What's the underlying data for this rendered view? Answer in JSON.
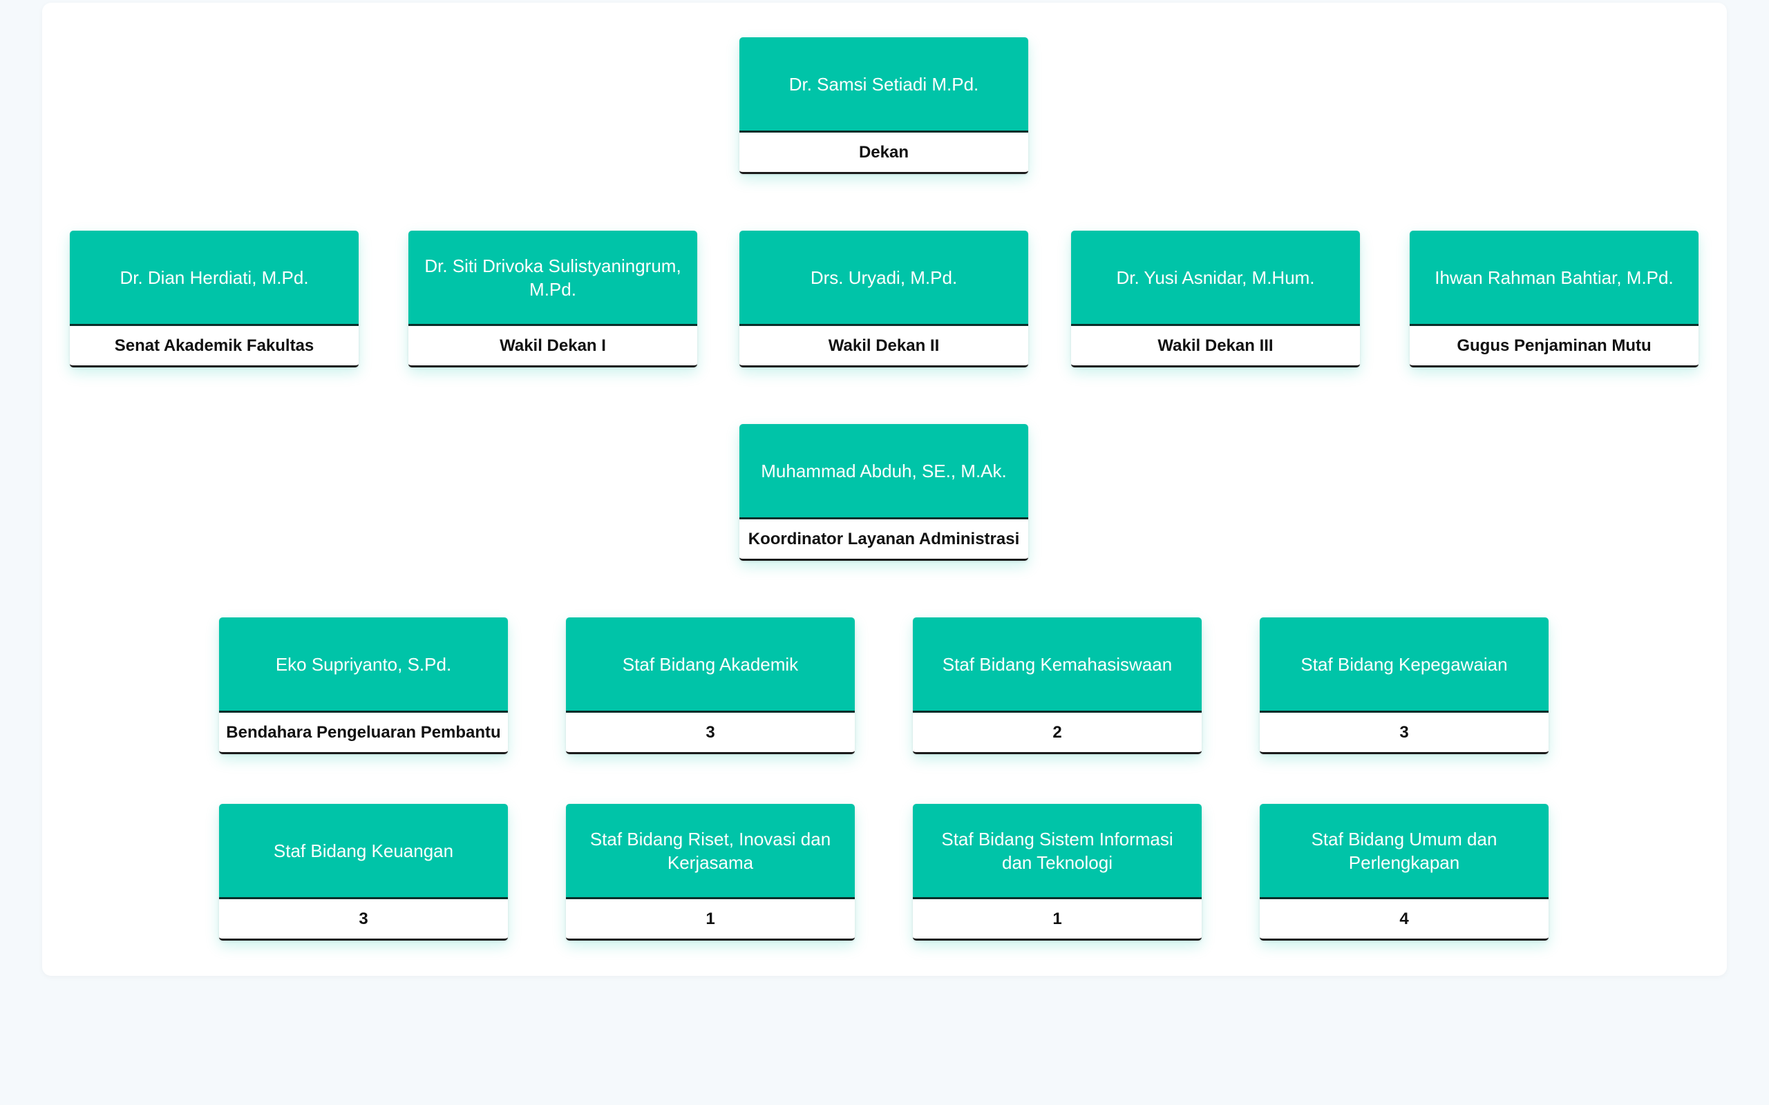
{
  "accent_color": "#00c4a8",
  "org": {
    "head": {
      "name": "Dr. Samsi Setiadi M.Pd.",
      "role": "Dekan"
    },
    "level2": [
      {
        "name": "Dr. Dian Herdiati, M.Pd.",
        "role": "Senat Akademik Fakultas"
      },
      {
        "name": "Dr. Siti Drivoka Sulistyaningrum, M.Pd.",
        "role": "Wakil Dekan I"
      },
      {
        "name": "Drs. Uryadi, M.Pd.",
        "role": "Wakil Dekan II"
      },
      {
        "name": "Dr. Yusi Asnidar, M.Hum.",
        "role": "Wakil Dekan III"
      },
      {
        "name": "Ihwan Rahman Bahtiar, M.Pd.",
        "role": "Gugus Penjaminan Mutu"
      }
    ],
    "coordinator": {
      "name": "Muhammad Abduh, SE., M.Ak.",
      "role": "Koordinator Layanan Administrasi"
    },
    "staff_row1": [
      {
        "name": "Eko Supriyanto, S.Pd.",
        "role": "Bendahara Pengeluaran Pembantu"
      },
      {
        "name": "Staf Bidang Akademik",
        "role": "3"
      },
      {
        "name": "Staf Bidang Kemahasiswaan",
        "role": "2"
      },
      {
        "name": "Staf Bidang Kepegawaian",
        "role": "3"
      }
    ],
    "staff_row2": [
      {
        "name": "Staf Bidang Keuangan",
        "role": "3"
      },
      {
        "name": "Staf Bidang Riset, Inovasi dan Kerjasama",
        "role": "1"
      },
      {
        "name": "Staf Bidang Sistem Informasi dan Teknologi",
        "role": "1"
      },
      {
        "name": "Staf Bidang Umum dan Perlengkapan",
        "role": "4"
      }
    ]
  }
}
